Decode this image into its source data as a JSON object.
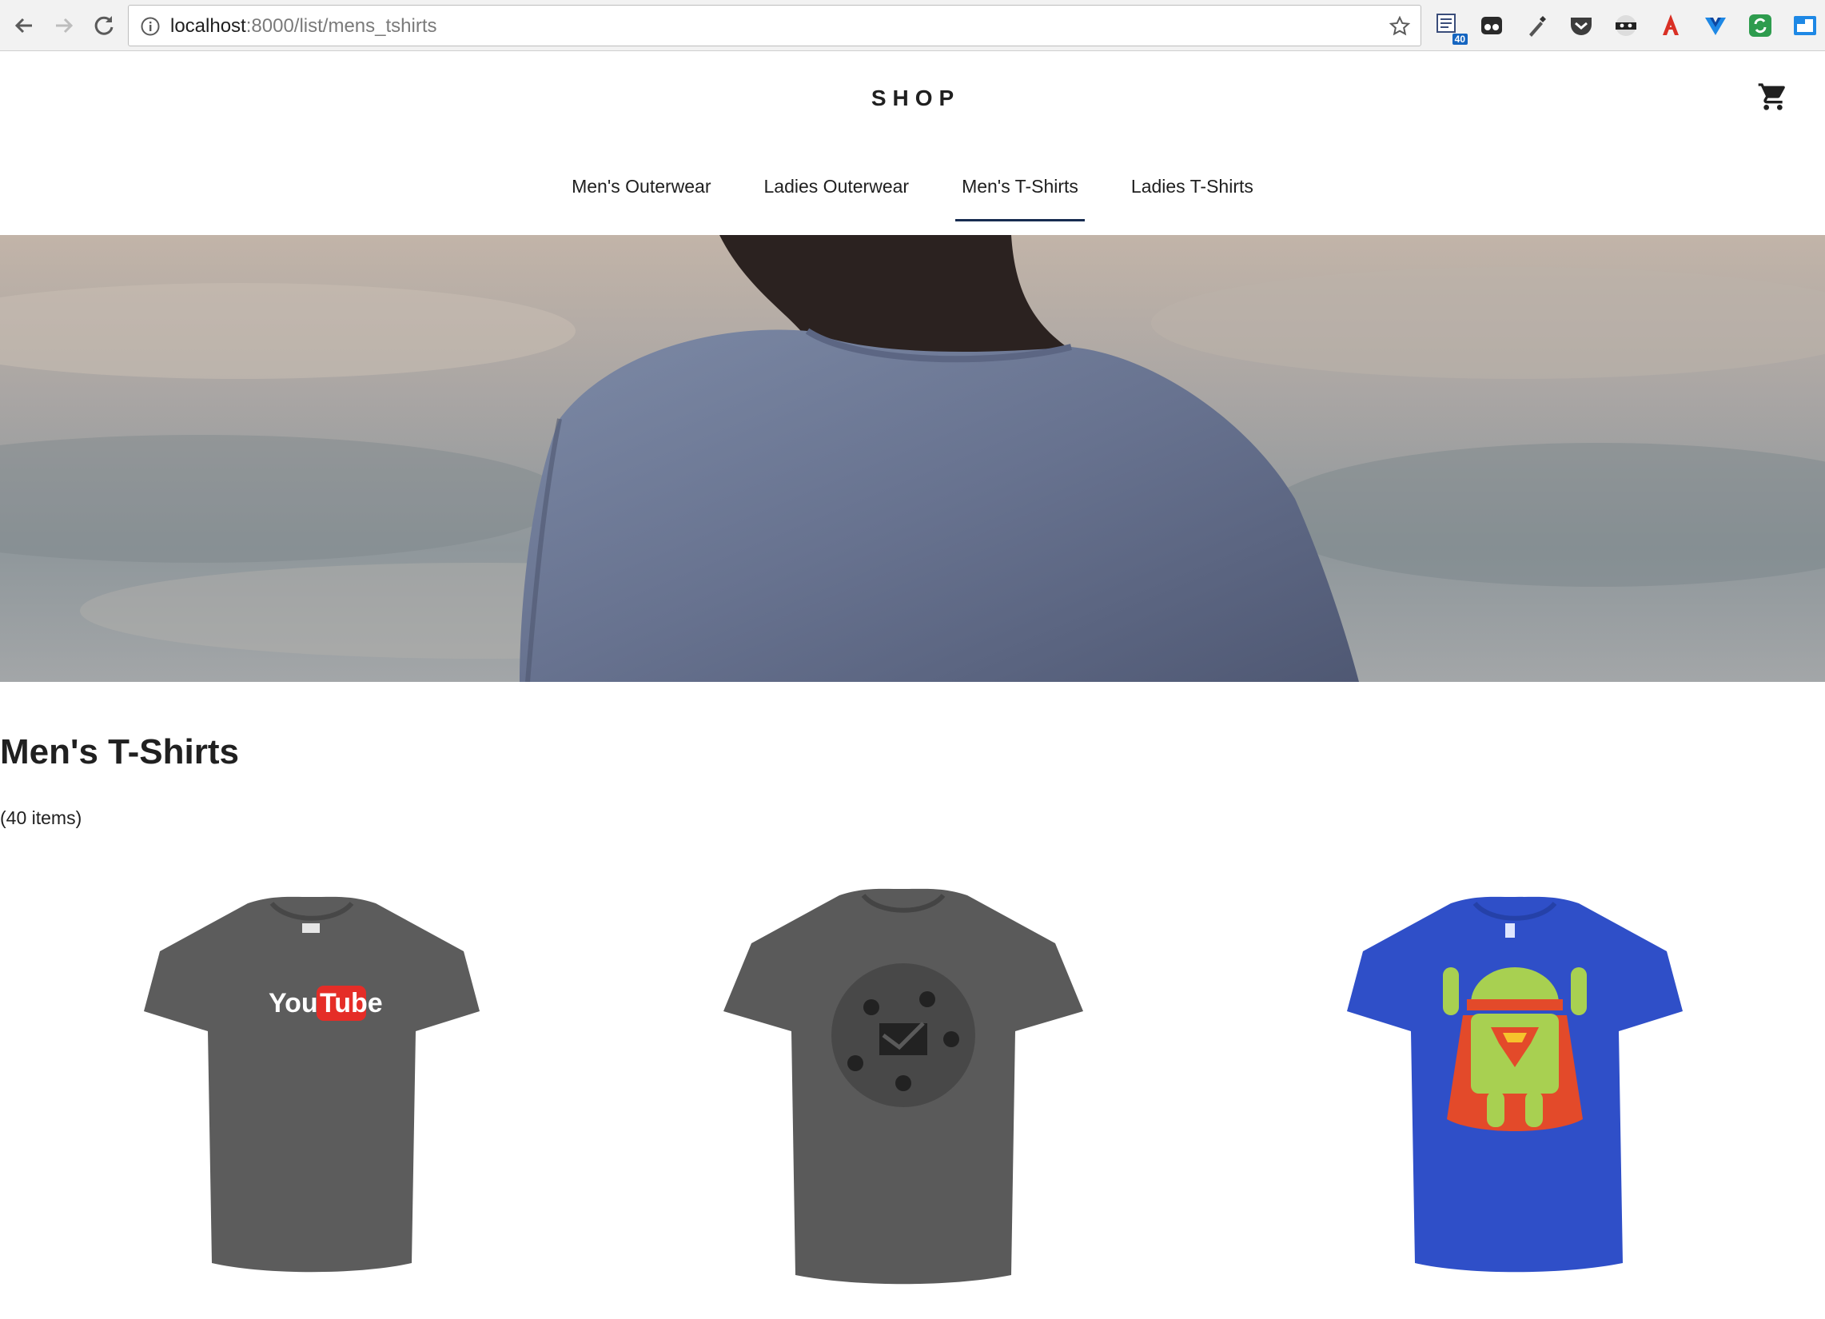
{
  "browser": {
    "url_host": "localhost",
    "url_path": ":8000/list/mens_tshirts",
    "extensions": [
      {
        "icon": "tab-counter-icon",
        "badge": "40"
      },
      {
        "icon": "incognito-mask-icon"
      },
      {
        "icon": "eyedropper-icon"
      },
      {
        "icon": "pocket-icon"
      },
      {
        "icon": "ninja-mask-icon"
      },
      {
        "icon": "acrobat-icon"
      },
      {
        "icon": "vue-devtools-icon"
      },
      {
        "icon": "sync-icon"
      },
      {
        "icon": "window-icon"
      }
    ]
  },
  "header": {
    "logo": "SHOP",
    "cart_icon": "shopping-cart-icon"
  },
  "tabs": [
    {
      "label": "Men's Outerwear",
      "active": false
    },
    {
      "label": "Ladies Outerwear",
      "active": false
    },
    {
      "label": "Men's T-Shirts",
      "active": true
    },
    {
      "label": "Ladies T-Shirts",
      "active": false
    }
  ],
  "listing": {
    "title": "Men's T-Shirts",
    "count": "(40 items)"
  },
  "products": [
    {
      "shirt_color": "#5c5c5c",
      "print_text_1": "You",
      "print_text_2": "Tube"
    },
    {
      "shirt_color": "#5a5a5a"
    },
    {
      "shirt_color": "#2f4fc8"
    }
  ],
  "colors": {
    "tab_underline": "#172c50"
  }
}
